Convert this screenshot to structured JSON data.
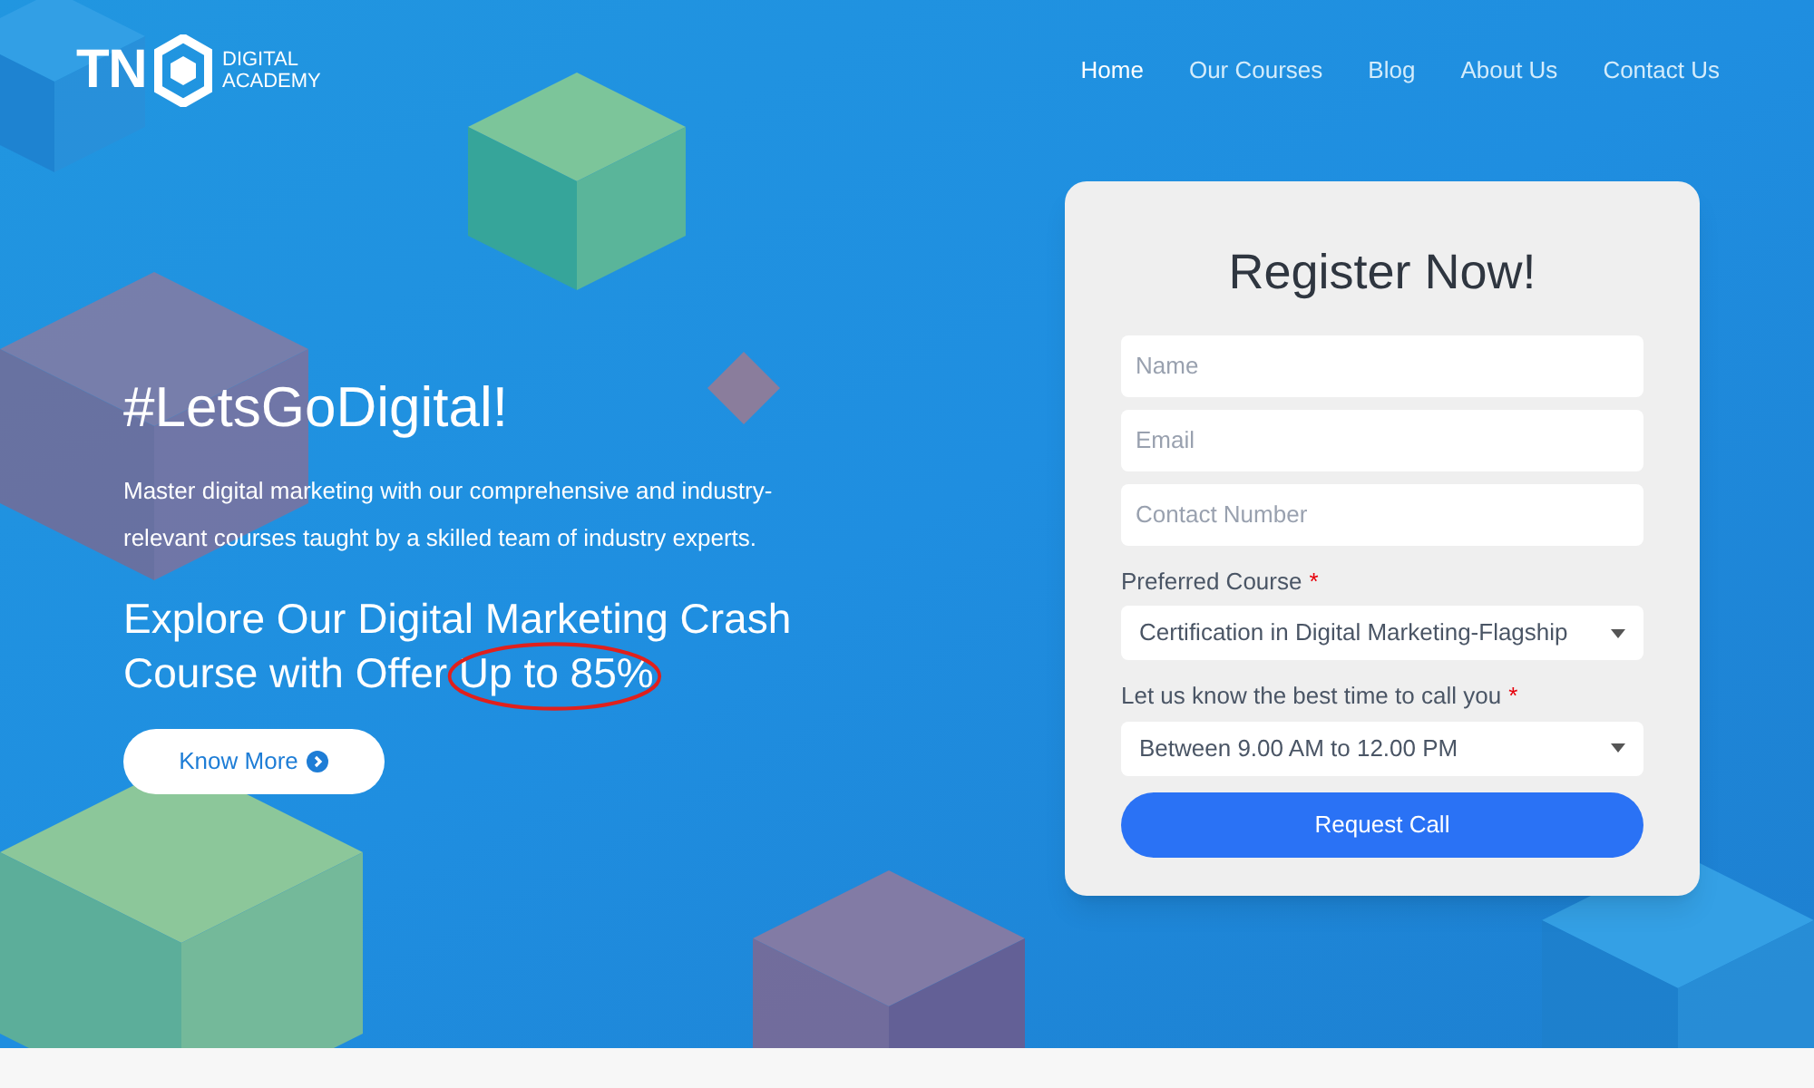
{
  "logo": {
    "letters": "TN",
    "line_1": "DIGITAL",
    "line_2": "ACADEMY"
  },
  "nav": [
    {
      "label": "Home",
      "selected": true
    },
    {
      "label": "Our Courses",
      "selected": false
    },
    {
      "label": "Blog",
      "selected": false
    },
    {
      "label": "About Us",
      "selected": false
    },
    {
      "label": "Contact Us",
      "selected": false
    }
  ],
  "hero": {
    "title": "#LetsGoDigital!",
    "description": "Master digital marketing with our comprehensive and industry-relevant courses taught by a skilled team of industry experts.",
    "offer": "Explore Our Digital Marketing Crash Course with Offer",
    "offer_highlight": "Up to 85%",
    "button": "Know More"
  },
  "form": {
    "title": "Register Now!",
    "fields": [
      {
        "kind": "input",
        "placeholder": "Name"
      },
      {
        "kind": "input",
        "placeholder": "Email"
      },
      {
        "kind": "input",
        "placeholder": "Contact Number"
      },
      {
        "kind": "select",
        "label": "Preferred Course",
        "required": true,
        "value": "Certification in Digital Marketing-Flagship"
      },
      {
        "kind": "select",
        "label": "Let us know the best time to call you",
        "required": true,
        "value": "Between 9.00 AM to 12.00 PM"
      }
    ],
    "submit": "Request Call",
    "required_mark": "*"
  }
}
